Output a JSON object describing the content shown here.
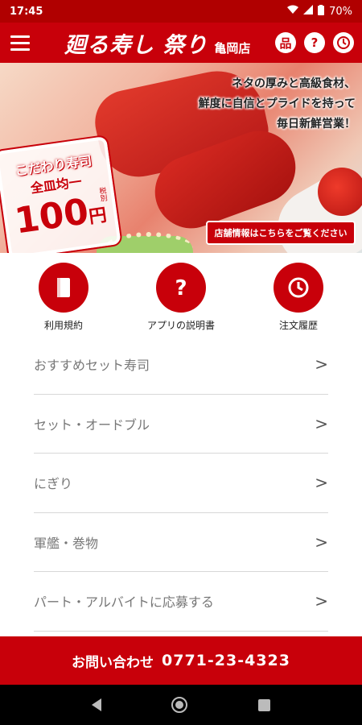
{
  "status": {
    "time": "17:45",
    "battery": "70%"
  },
  "header": {
    "brand": "廻る寿し 祭り",
    "branch": "亀岡店",
    "actions": [
      {
        "icon": "menu-book-icon",
        "glyph": "品"
      },
      {
        "icon": "help-icon",
        "glyph": "?"
      },
      {
        "icon": "clock-icon",
        "glyph": "◷"
      }
    ]
  },
  "hero": {
    "badge_line1": "こだわり寿司",
    "badge_line2": "全皿均一",
    "badge_price": "100",
    "badge_yen": "円",
    "badge_tax": "税別",
    "copy": [
      "ネタの厚みと高級食材、",
      "鮮度に自信とプライドを持って",
      "毎日新鮮営業！"
    ],
    "store_button": "店舗情報はこちらをご覧ください"
  },
  "quick_links": [
    {
      "label": "利用規約",
      "icon": "book-icon"
    },
    {
      "label": "アプリの説明書",
      "icon": "question-icon"
    },
    {
      "label": "注文履歴",
      "icon": "history-clock-icon"
    }
  ],
  "menu": [
    {
      "label": "おすすめセット寿司"
    },
    {
      "label": "セット・オードブル"
    },
    {
      "label": "にぎり"
    },
    {
      "label": "軍艦・巻物"
    },
    {
      "label": "パート・アルバイトに応募する"
    }
  ],
  "chevron": ">",
  "contact": {
    "label": "お問い合わせ",
    "phone": "0771-23-4323"
  },
  "colors": {
    "brand_red": "#c8000a",
    "status_red": "#b00000"
  }
}
